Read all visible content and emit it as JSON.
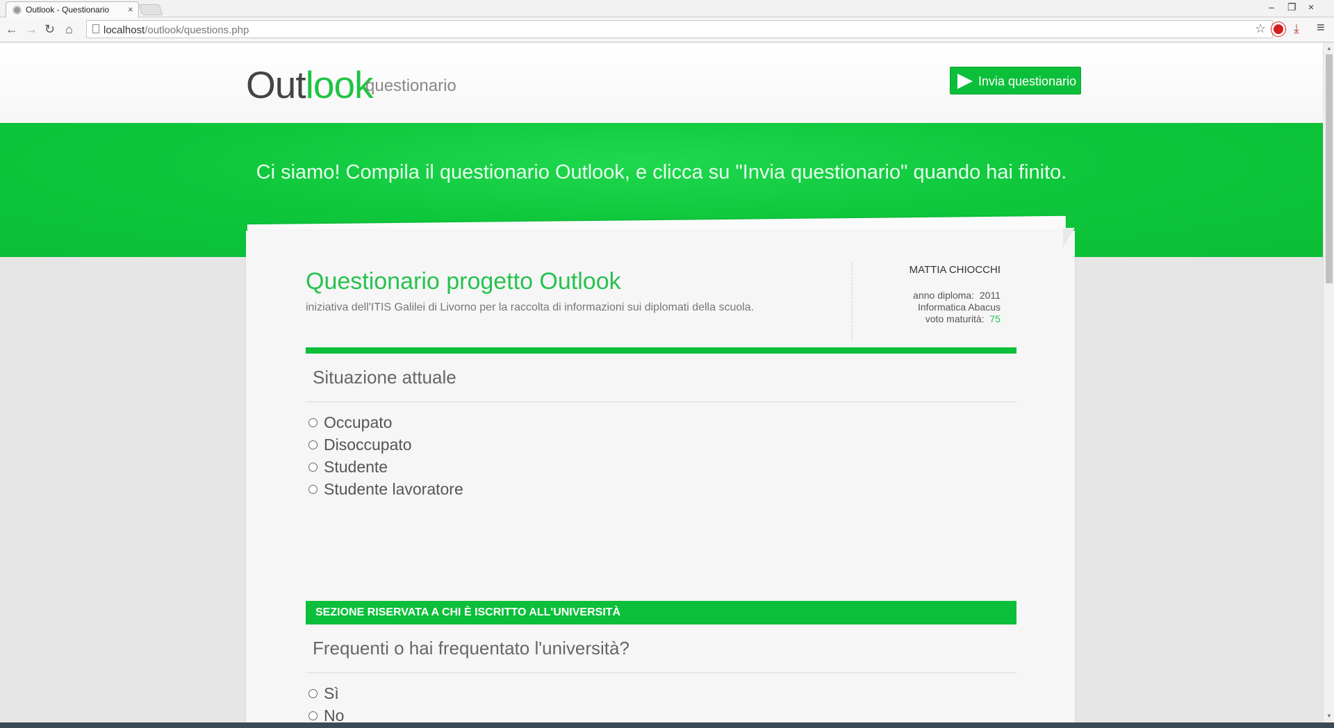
{
  "browser": {
    "tab_title": "Outlook - Questionario",
    "tab_close": "×",
    "url_host": "localhost",
    "url_path": "/outlook/questions.php",
    "window_controls": [
      "‒",
      "❐",
      "×"
    ],
    "icons": [
      "back-arrow-icon",
      "forward-arrow-icon",
      "reload-icon",
      "home-icon",
      "bookmark-star-icon",
      "extension-icon",
      "download-icon",
      "menu-icon"
    ]
  },
  "header": {
    "logo_main": "Out",
    "logo_accent": "look",
    "logo_sub": "questionario",
    "send_button": "Invia questionario"
  },
  "hero": {
    "text": "Ci siamo! Compila il questionario Outlook, e clicca su \"Invia questionario\" quando hai finito."
  },
  "card": {
    "title": "Questionario progetto Outlook",
    "subtitle": "iniziativa dell'ITIS Galilei di Livorno per la raccolta di informazioni sui diplomati della scuola.",
    "student": {
      "name": "MATTIA CHIOCCHI",
      "year_label": "anno diploma:",
      "year_value": "2011",
      "course": "Informatica Abacus",
      "grade_label": "voto maturità:",
      "grade_value": "75"
    }
  },
  "questions": [
    {
      "title": "Situazione attuale",
      "options": [
        "Occupato",
        "Disoccupato",
        "Studente",
        "Studente lavoratore"
      ]
    },
    {
      "section": "SEZIONE RISERVATA A CHI È ISCRITTO ALL'UNIVERSITÀ",
      "title": "Frequenti o hai frequentato l'università?",
      "options": [
        "Sì",
        "No"
      ]
    }
  ],
  "colors": {
    "accent_green": "#0cbf3a",
    "title_green": "#27c24f"
  }
}
